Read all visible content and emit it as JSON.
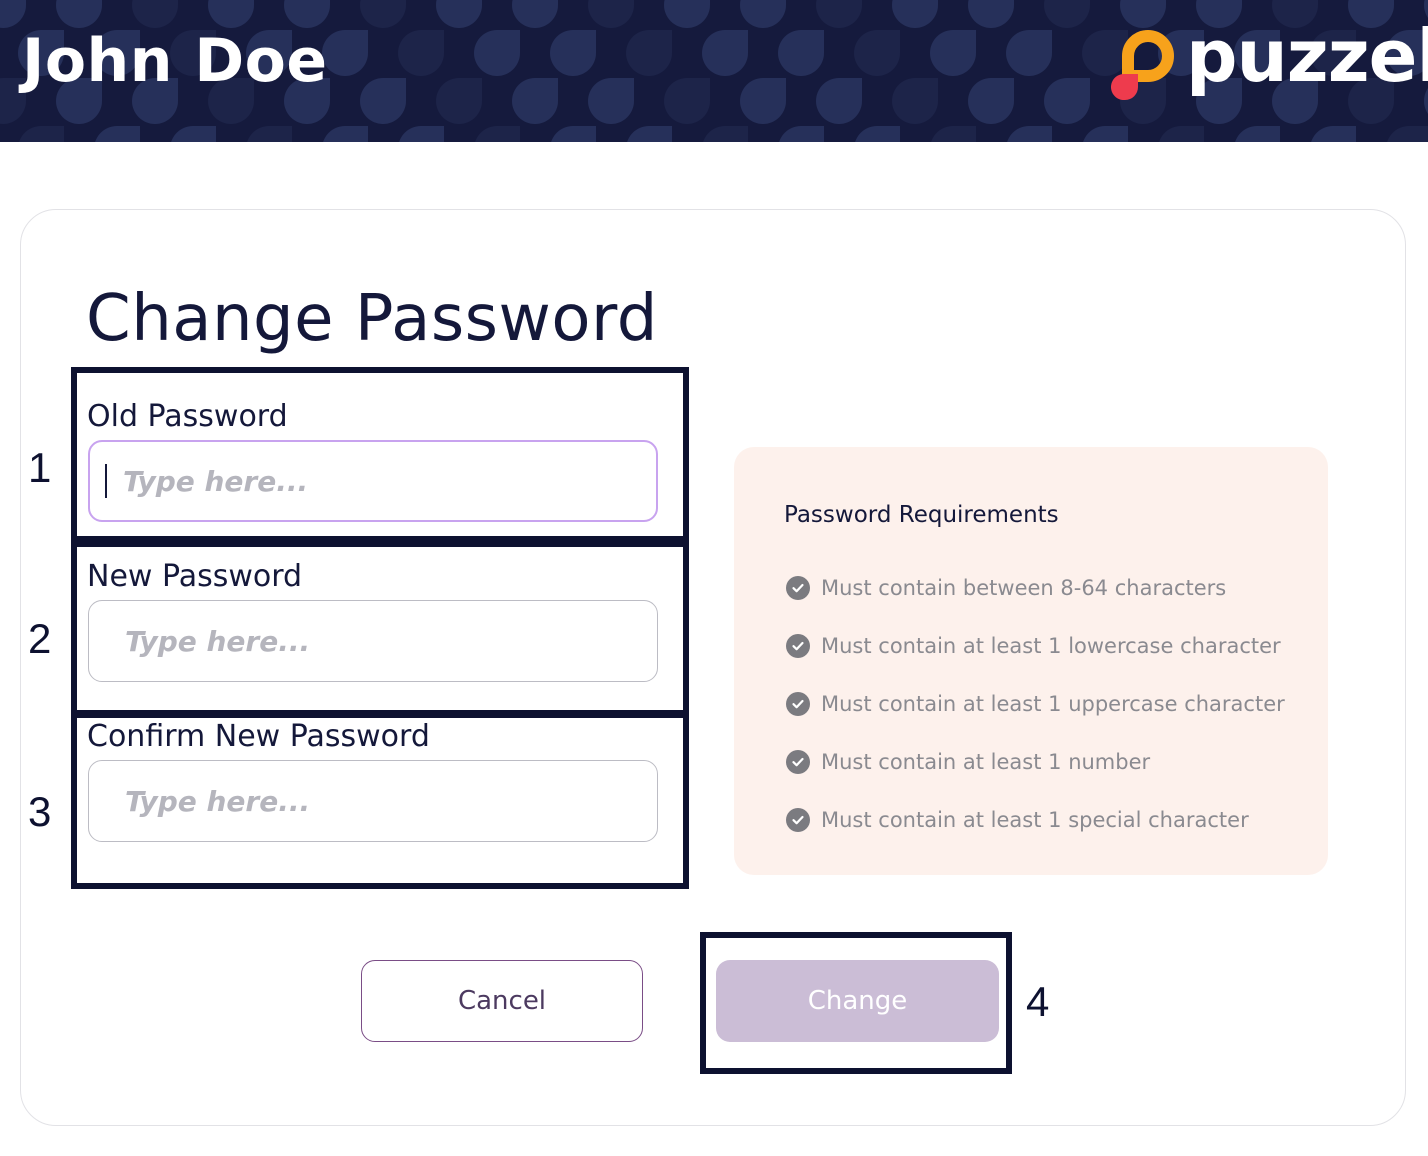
{
  "header": {
    "user_name": "John Doe",
    "logo_text": "puzzel",
    "background_color": "#151a3d"
  },
  "page": {
    "title": "Change Password"
  },
  "form": {
    "old_password": {
      "label": "Old Password",
      "placeholder": "Type here...",
      "value": ""
    },
    "new_password": {
      "label": "New Password",
      "placeholder": "Type here...",
      "value": ""
    },
    "confirm_password": {
      "label": "Confirm New Password",
      "placeholder": "Type here...",
      "value": ""
    }
  },
  "requirements": {
    "title": "Password Requirements",
    "items": [
      {
        "text": "Must contain between 8-64 characters",
        "icon": "check-circle-icon"
      },
      {
        "text": "Must contain at least 1 lowercase character",
        "icon": "check-circle-icon"
      },
      {
        "text": "Must contain at least 1 uppercase character",
        "icon": "check-circle-icon"
      },
      {
        "text": "Must contain at least 1 number",
        "icon": "check-circle-icon"
      },
      {
        "text": "Must contain at least 1 special character",
        "icon": "check-circle-icon"
      }
    ]
  },
  "actions": {
    "cancel_label": "Cancel",
    "change_label": "Change"
  },
  "annotations": {
    "step1": "1",
    "step2": "2",
    "step3": "3",
    "step4": "4"
  },
  "colors": {
    "accent_focus": "#c8a3ef",
    "change_disabled": "#cbbdd6",
    "requirements_bg": "#fdf1ec",
    "logo_orange": "#f7a21b",
    "logo_red": "#ee3b4d"
  }
}
